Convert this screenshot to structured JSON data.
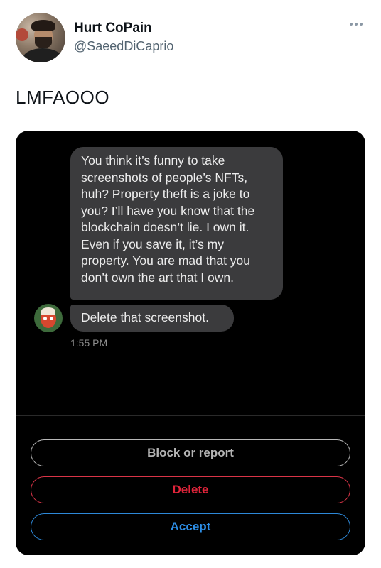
{
  "author": {
    "name": "Hurt CoPain",
    "handle": "@SaeedDiCaprio"
  },
  "tweet": {
    "text": "LMFAOOO"
  },
  "icons": {
    "more": "more-horizontal-icon"
  },
  "screenshot": {
    "messages": [
      {
        "text": "You think it’s funny to take screenshots of people’s NFTs, huh? Property theft is a joke to you? I’ll have you know that the blockchain doesn’t lie. I own it. Even if you save it, it’s my property. You are mad that you don’t own the art that I own."
      },
      {
        "text": "Delete that screenshot."
      }
    ],
    "timestamp": "1:55 PM",
    "buttons": {
      "block_report": "Block or report",
      "delete": "Delete",
      "accept": "Accept"
    }
  },
  "colors": {
    "card_background": "#000000",
    "bubble": "#3b3b3d",
    "delete": "#e0243a",
    "accept": "#2d8ee6"
  }
}
